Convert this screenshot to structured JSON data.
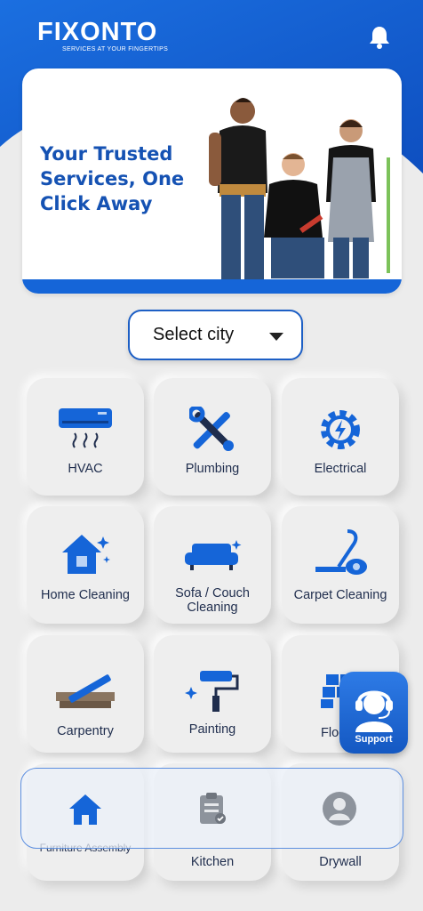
{
  "app": {
    "logo": "FIXONTO",
    "tagline": "SERVICES AT YOUR FINGERTIPS"
  },
  "banner": {
    "headline": "Your Trusted Services, One Click Away"
  },
  "city_select": {
    "label": "Select city"
  },
  "services": [
    {
      "label": "HVAC",
      "icon": "air-conditioner-icon"
    },
    {
      "label": "Plumbing",
      "icon": "tools-icon"
    },
    {
      "label": "Electrical",
      "icon": "electrical-gear-icon"
    },
    {
      "label": "Home Cleaning",
      "icon": "house-sparkle-icon"
    },
    {
      "label": "Sofa / Couch Cleaning",
      "icon": "sofa-icon"
    },
    {
      "label": "Carpet Cleaning",
      "icon": "vacuum-icon"
    },
    {
      "label": "Carpentry",
      "icon": "saw-icon"
    },
    {
      "label": "Painting",
      "icon": "paint-roller-icon"
    },
    {
      "label": "Floo",
      "icon": "floor-tiles-icon"
    },
    {
      "label": "Furniture Assembly",
      "icon": "furniture-icon"
    },
    {
      "label": "Kitchen",
      "icon": "kitchen-icon"
    },
    {
      "label": "Drywall",
      "icon": "drywall-icon"
    }
  ],
  "support": {
    "label": "Support"
  },
  "bottom_nav": {
    "items": [
      {
        "name": "home",
        "icon": "home-icon"
      },
      {
        "name": "orders",
        "icon": "clipboard-icon"
      },
      {
        "name": "profile",
        "icon": "user-icon"
      }
    ]
  },
  "colors": {
    "primary": "#1565d8",
    "text": "#1f2d4d",
    "background": "#ececec"
  }
}
